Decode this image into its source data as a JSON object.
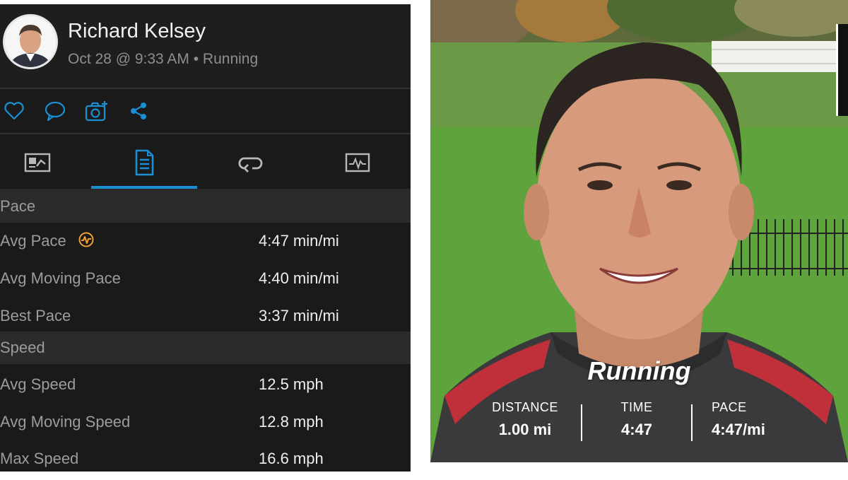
{
  "profile": {
    "name": "Richard Kelsey",
    "meta": "Oct 28 @ 9:33 AM • Running"
  },
  "actions": {
    "icons": [
      "heart-icon",
      "comment-icon",
      "add-photo-icon",
      "share-icon"
    ],
    "accent": "#1a8fd4"
  },
  "tabs": {
    "items": [
      "overview-tab",
      "stats-tab",
      "laps-tab",
      "charts-tab"
    ],
    "selected_index": 1
  },
  "stats": {
    "pace_section": "Pace",
    "avg_pace_label": "Avg Pace",
    "avg_pace_value": "4:47 min/mi",
    "avg_moving_pace_label": "Avg Moving Pace",
    "avg_moving_pace_value": "4:40 min/mi",
    "best_pace_label": "Best Pace",
    "best_pace_value": "3:37 min/mi",
    "speed_section": "Speed",
    "avg_speed_label": "Avg Speed",
    "avg_speed_value": "12.5 mph",
    "avg_moving_speed_label": "Avg Moving Speed",
    "avg_moving_speed_value": "12.8 mph",
    "max_speed_label": "Max Speed",
    "max_speed_value": "16.6 mph"
  },
  "photo_overlay": {
    "title": "Running",
    "distance_label": "DISTANCE",
    "distance_value": "1.00 mi",
    "time_label": "TIME",
    "time_value": "4:47",
    "pace_label": "PACE",
    "pace_value": "4:47/mi"
  },
  "colors": {
    "panel_bg": "#1a1a1a",
    "section_bg": "#2b2b2b",
    "accent": "#1a8fd4",
    "pace_icon": "#f0a030"
  }
}
